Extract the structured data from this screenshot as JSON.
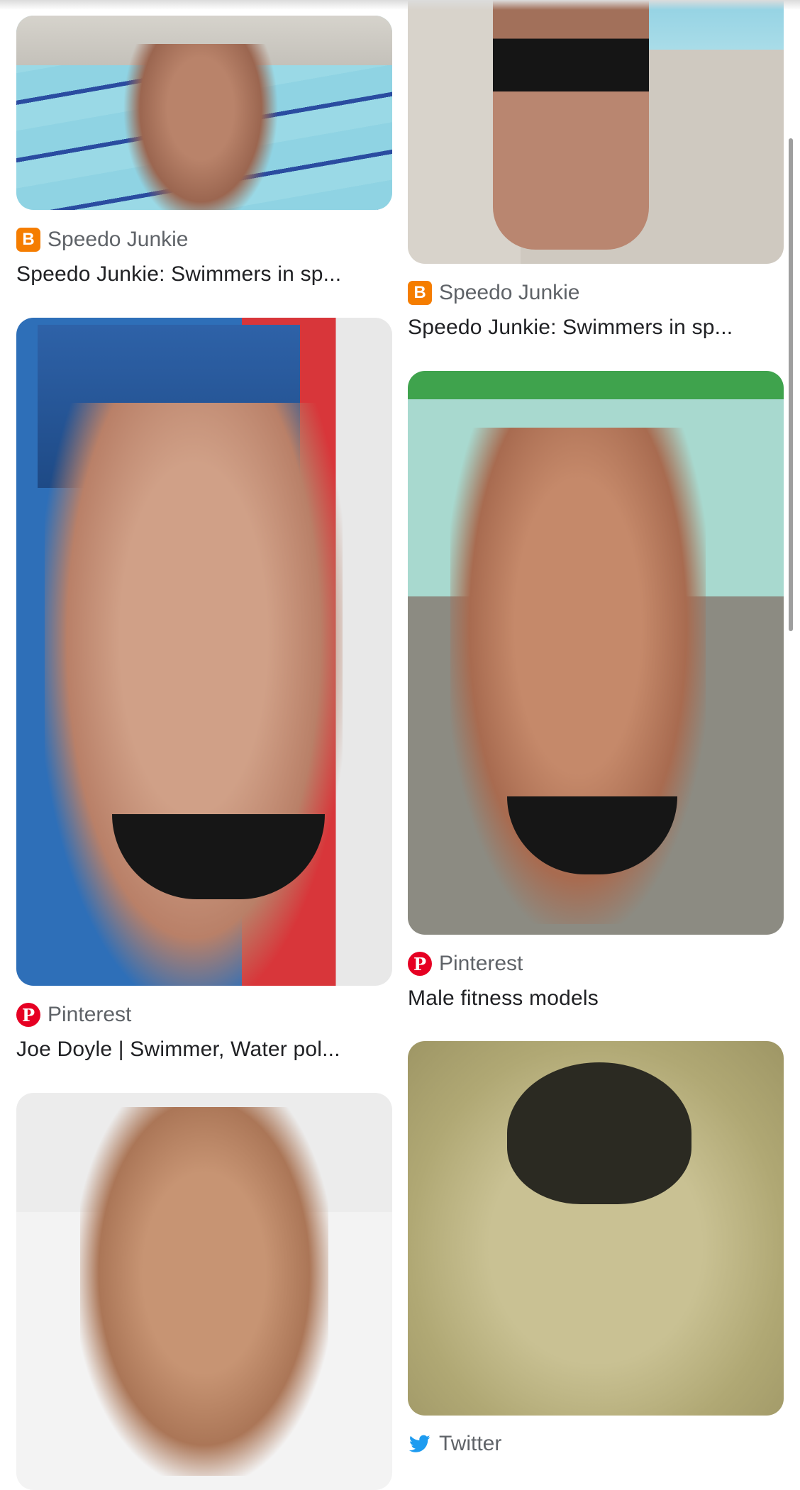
{
  "results": {
    "left": [
      {
        "source": "Speedo Junkie",
        "source_icon": "blogger-icon",
        "title": "Speedo Junkie: Swimmers in sp..."
      },
      {
        "source": "Pinterest",
        "source_icon": "pinterest-icon",
        "title": "Joe Doyle | Swimmer, Water pol..."
      },
      {
        "source": "",
        "title": ""
      }
    ],
    "right": [
      {
        "source": "Speedo Junkie",
        "source_icon": "blogger-icon",
        "title": "Speedo Junkie: Swimmers in sp..."
      },
      {
        "source": "Pinterest",
        "source_icon": "pinterest-icon",
        "title": "Male fitness models"
      },
      {
        "source": "Twitter",
        "source_icon": "twitter-icon",
        "title": ""
      }
    ]
  },
  "icons": {
    "blogger_glyph": "B",
    "pinterest_glyph": "P"
  },
  "colors": {
    "blogger": "#f57d00",
    "pinterest": "#e60023",
    "twitter": "#1d9bf0",
    "source_text": "#5f6368",
    "title_text": "#202124"
  }
}
